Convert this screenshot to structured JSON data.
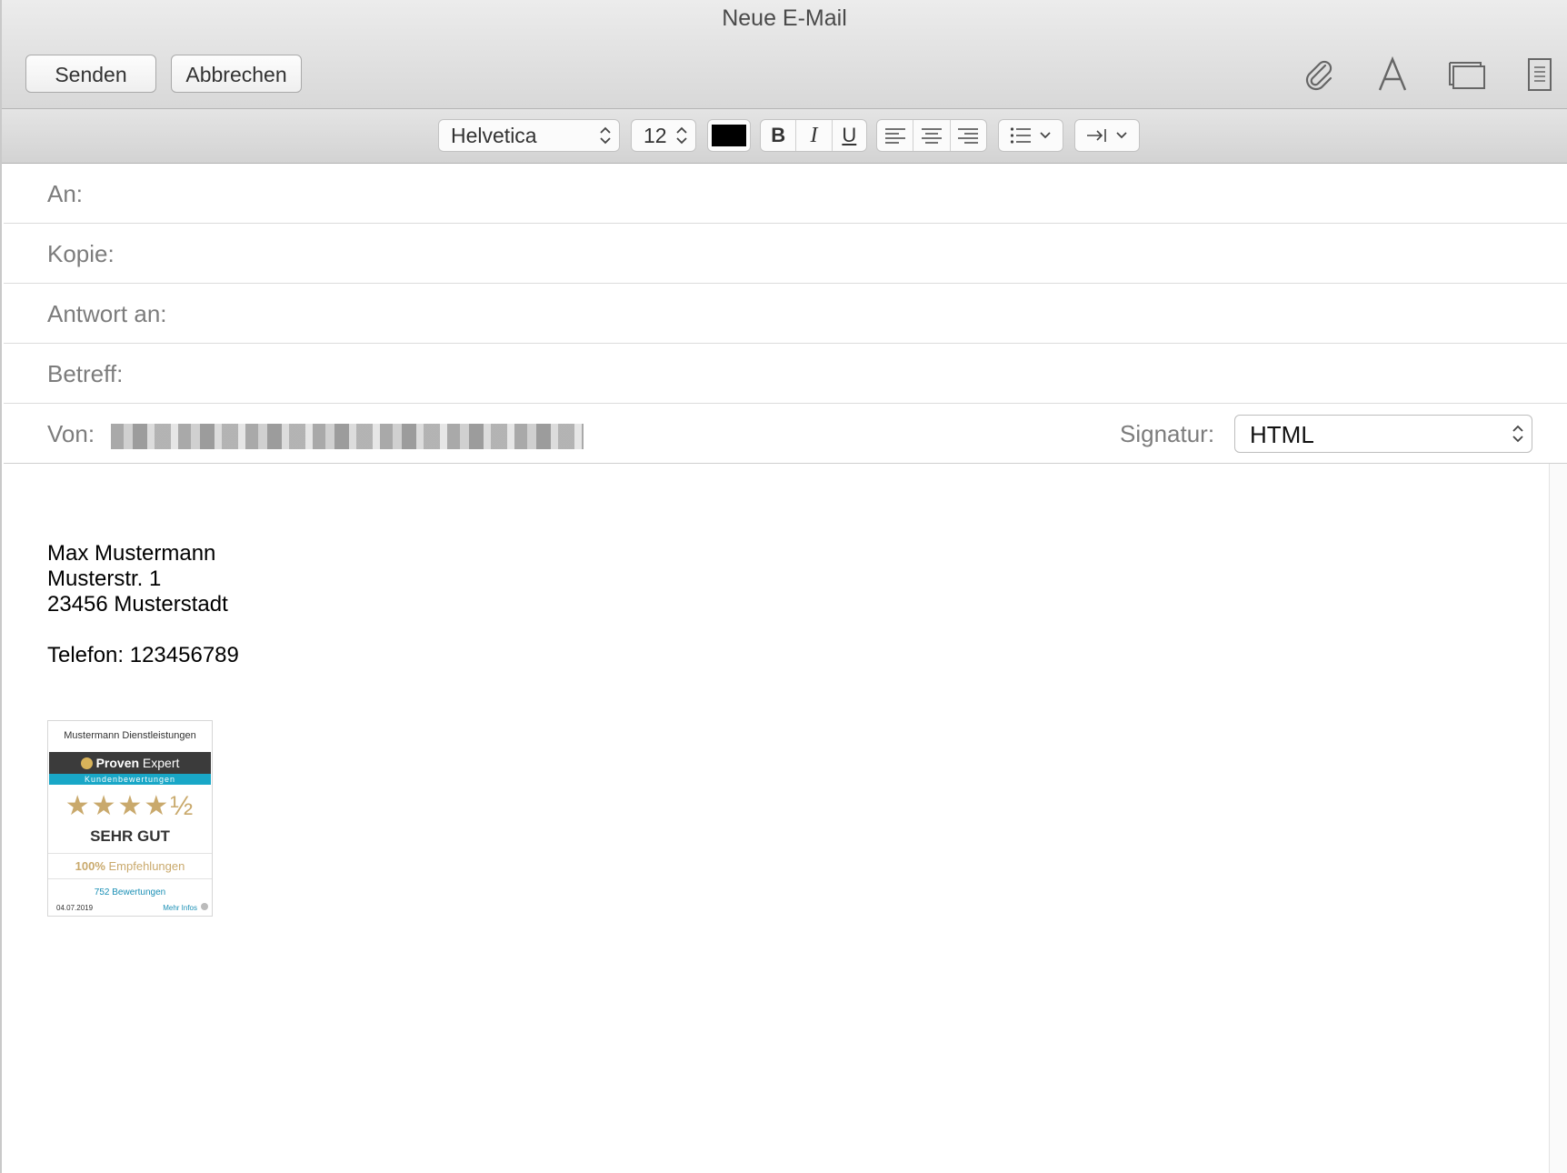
{
  "window": {
    "title": "Neue E-Mail"
  },
  "toolbar": {
    "send_label": "Senden",
    "cancel_label": "Abbrechen",
    "icons": [
      "paperclip-icon",
      "font-icon",
      "window-icon",
      "stationery-icon"
    ]
  },
  "formatbar": {
    "font": "Helvetica",
    "size": "12",
    "color": "#000000",
    "bold": "B",
    "italic": "I",
    "underline": "U"
  },
  "fields": {
    "to_label": "An:",
    "cc_label": "Kopie:",
    "reply_to_label": "Antwort an:",
    "subject_label": "Betreff:",
    "from_label": "Von:",
    "signature_label": "Signatur:",
    "signature_value": "HTML"
  },
  "body": {
    "lines": [
      "Max Mustermann",
      "Musterstr. 1",
      "23456 Musterstadt",
      "",
      "Telefon: 123456789"
    ]
  },
  "badge": {
    "company": "Mustermann Dienstleistungen",
    "brand_bold": "Proven",
    "brand_light": " Expert",
    "subtitle": "Kundenbewertungen",
    "stars": "★★★★½",
    "rating_value": 4.5,
    "rating_text": "SEHR GUT",
    "recommendation_pct": "100%",
    "recommendation_text": " Empfehlungen",
    "reviews": "752 Bewertungen",
    "date": "04.07.2019",
    "more": "Mehr Infos"
  }
}
